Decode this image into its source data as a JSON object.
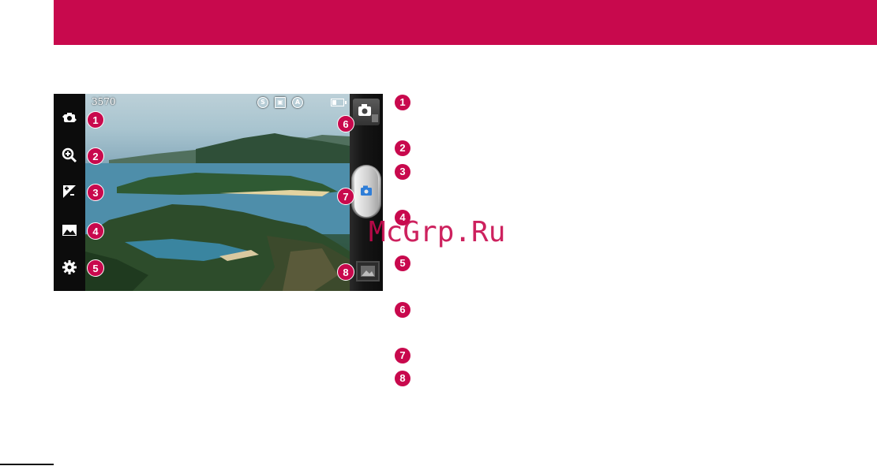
{
  "camera": {
    "shots_remaining": "3570",
    "status_icons": [
      "timer-icon",
      "image-size-icon",
      "auto-flash-icon",
      "battery-icon"
    ],
    "left_toolbar": [
      "swap-camera-icon",
      "zoom-icon",
      "brightness-icon",
      "scene-mode-icon",
      "settings-icon"
    ],
    "callouts": [
      "1",
      "2",
      "3",
      "4",
      "5",
      "6",
      "7",
      "8"
    ]
  },
  "legend": {
    "markers": [
      "1",
      "2",
      "3",
      "4",
      "5",
      "6",
      "7",
      "8"
    ]
  },
  "watermark": "McGrp.Ru",
  "colors": {
    "accent": "#c8094d"
  }
}
